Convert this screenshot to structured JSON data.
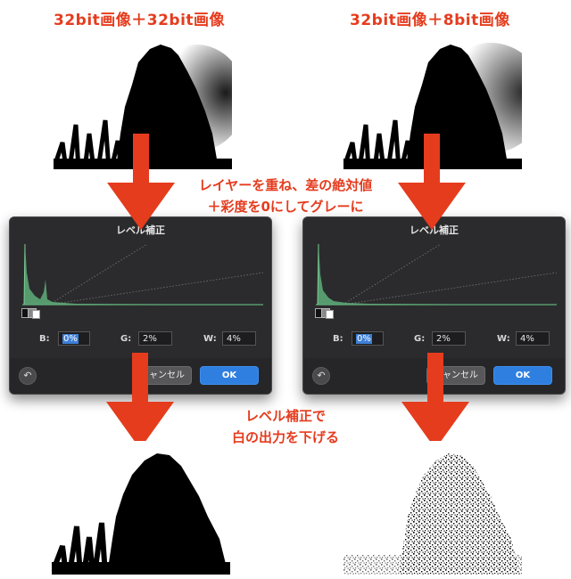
{
  "headings": {
    "left": "32bit画像＋32bit画像",
    "right": "32bit画像＋8bit画像"
  },
  "notes": {
    "middle_line1": "レイヤーを重ね、差の絶対値",
    "middle_line2": "＋彩度を0にしてグレーに",
    "bottom_line1": "レベル補正で",
    "bottom_line2": "白の出力を下げる"
  },
  "dialogs": [
    {
      "title": "レベル補正",
      "b_label": "B:",
      "b_value": "0%",
      "g_label": "G:",
      "g_value": "2%",
      "w_label": "W:",
      "w_value": "4%",
      "undo_icon": "↶",
      "cancel_label": "キャンセル",
      "ok_label": "OK"
    },
    {
      "title": "レベル補正",
      "b_label": "B:",
      "b_value": "0%",
      "g_label": "G:",
      "g_value": "2%",
      "w_label": "W:",
      "w_value": "4%",
      "undo_icon": "↶",
      "cancel_label": "キャンセル",
      "ok_label": "OK"
    }
  ],
  "colors": {
    "annotation_red": "#e53c1e",
    "dialog_bg": "#2b2b2d",
    "ok_blue": "#2f7fe0",
    "histogram_green": "#5fae7a"
  }
}
